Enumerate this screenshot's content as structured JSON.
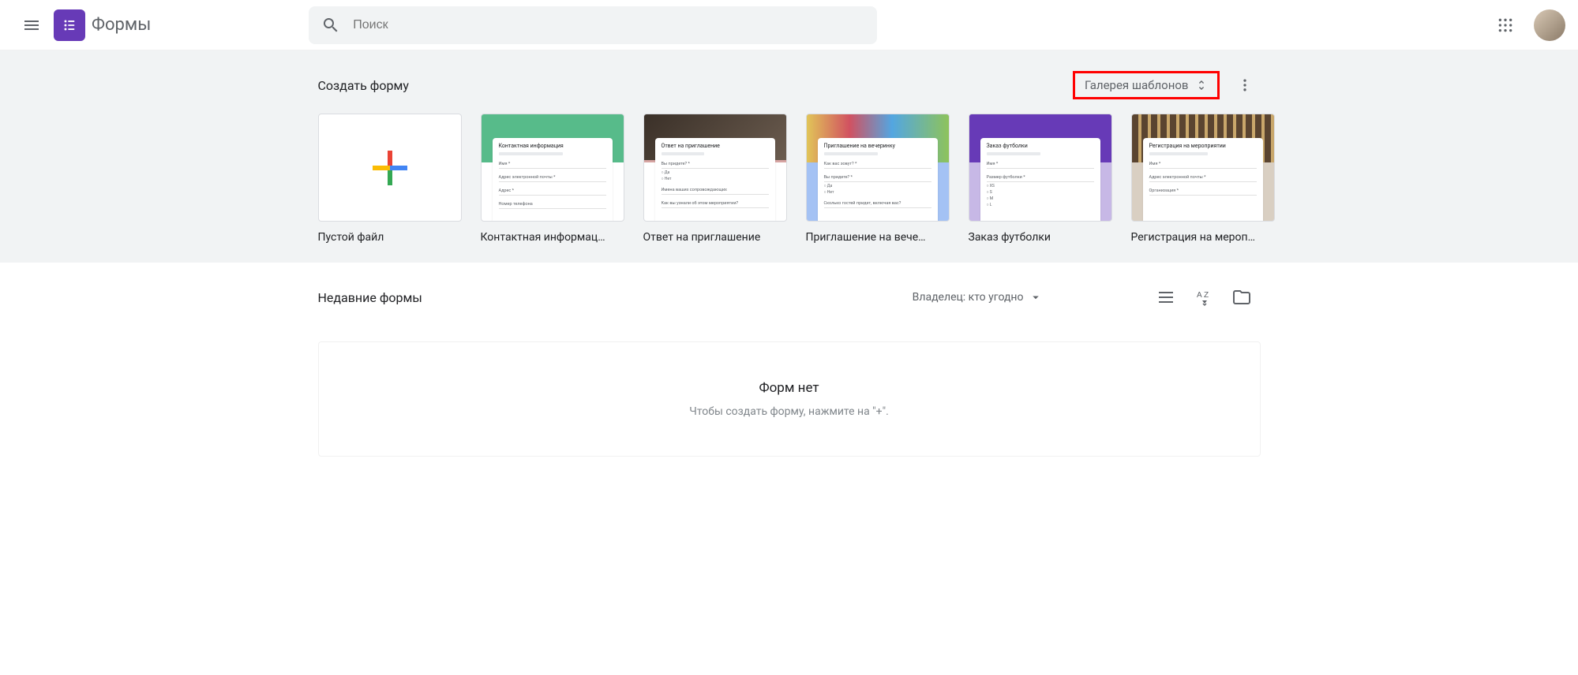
{
  "header": {
    "app_name": "Формы",
    "search_placeholder": "Поиск"
  },
  "gallery": {
    "title": "Создать форму",
    "toggle_label": "Галерея шаблонов",
    "templates": [
      {
        "label": "Пустой файл",
        "preview_title": ""
      },
      {
        "label": "Контактная информац…",
        "preview_title": "Контактная информация"
      },
      {
        "label": "Ответ на приглашение",
        "preview_title": "Ответ на приглашение"
      },
      {
        "label": "Приглашение на вече…",
        "preview_title": "Приглашение на вечеринку"
      },
      {
        "label": "Заказ футболки",
        "preview_title": "Заказ футболки"
      },
      {
        "label": "Регистрация на мероп…",
        "preview_title": "Регистрация на мероприятии"
      }
    ]
  },
  "recent": {
    "title": "Недавние формы",
    "owner_filter": "Владелец: кто угодно",
    "empty_title": "Форм нет",
    "empty_subtitle": "Чтобы создать форму, нажмите на \"+\"."
  },
  "colors": {
    "brand": "#673ab7",
    "red_plus": "#ea4335",
    "yellow_plus": "#fbbc04",
    "green_plus": "#34a853",
    "blue_plus": "#4285f4",
    "template_green": "#57bb8a",
    "template_pink": "#d7a5a3",
    "template_blue": "#a4c2f4",
    "template_purple": "#673ab7",
    "template_brown": "#7a5c3e"
  }
}
